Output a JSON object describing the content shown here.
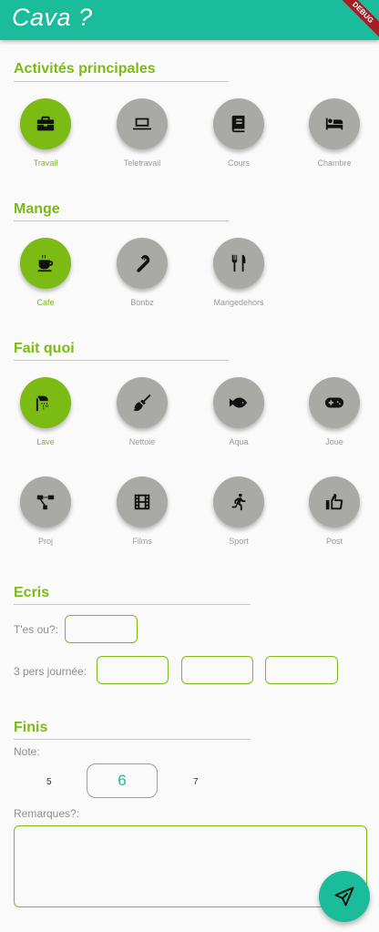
{
  "app": {
    "title": "Cava ?",
    "debug_banner": "DEBUG"
  },
  "sections": {
    "activites": {
      "title": "Activités principales",
      "items": [
        {
          "label": "Travail",
          "icon": "briefcase-icon",
          "selected": true
        },
        {
          "label": "Teletravail",
          "icon": "laptop-icon",
          "selected": false
        },
        {
          "label": "Cours",
          "icon": "book-icon",
          "selected": false
        },
        {
          "label": "Chambre",
          "icon": "bed-icon",
          "selected": false
        }
      ]
    },
    "mange": {
      "title": "Mange",
      "items": [
        {
          "label": "Cafe",
          "icon": "coffee-icon",
          "selected": true
        },
        {
          "label": "Bonbz",
          "icon": "candy-cane-icon",
          "selected": false
        },
        {
          "label": "Mangedehors",
          "icon": "fork-knife-icon",
          "selected": false
        }
      ]
    },
    "fait_quoi": {
      "title": "Fait quoi",
      "items": [
        {
          "label": "Lave",
          "icon": "shower-icon",
          "selected": true
        },
        {
          "label": "Nettoie",
          "icon": "broom-icon",
          "selected": false
        },
        {
          "label": "Aqua",
          "icon": "fish-icon",
          "selected": false
        },
        {
          "label": "Joue",
          "icon": "gamepad-icon",
          "selected": false
        },
        {
          "label": "Proj",
          "icon": "project-diagram-icon",
          "selected": false
        },
        {
          "label": "Films",
          "icon": "film-icon",
          "selected": false
        },
        {
          "label": "Sport",
          "icon": "running-icon",
          "selected": false
        },
        {
          "label": "Post",
          "icon": "thumbs-up-icon",
          "selected": false
        }
      ]
    },
    "ecris": {
      "title": "Ecris",
      "location_label": "T'es ou?:",
      "location_value": "",
      "people_label": "3 pers journée:",
      "people_values": [
        "",
        "",
        ""
      ]
    },
    "finis": {
      "title": "Finis",
      "note_label": "Note:",
      "note_options": [
        "5",
        "6",
        "7"
      ],
      "note_selected": "6",
      "remarks_label": "Remarques?:",
      "remarks_value": ""
    }
  },
  "fab": {
    "icon": "send-icon"
  },
  "colors": {
    "appbar": "#1abc9c",
    "accent": "#7cbb14",
    "inactive": "#a9aaa6",
    "fab": "#1abc9c"
  }
}
